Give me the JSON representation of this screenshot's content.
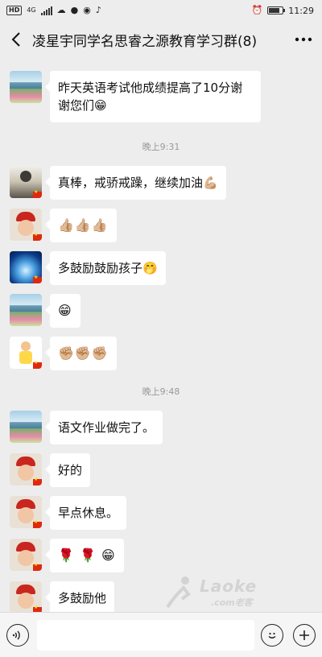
{
  "status_bar": {
    "hd_badge": "HD",
    "network": "4G",
    "time": "11:29"
  },
  "header": {
    "back_icon": "chevron-left-icon",
    "title": "凌星宇同学名思睿之源教育学习群(8)",
    "more_icon": "ellipsis-icon"
  },
  "messages": [
    {
      "avatar": "landscape",
      "text": "昨天英语考试他成绩提高了10分谢谢您们😁"
    },
    {
      "avatar": "girl",
      "text": "真棒，戒骄戒躁，继续加油💪🏼"
    },
    {
      "avatar": "boy",
      "text": "👍🏼👍🏼👍🏼"
    },
    {
      "avatar": "iceberg",
      "text": "多鼓励鼓励孩子🤭"
    },
    {
      "avatar": "landscape",
      "text": "😁"
    },
    {
      "avatar": "cartoon",
      "text": "✊🏼✊🏼✊🏼"
    },
    {
      "avatar": "landscape",
      "text": "语文作业做完了。"
    },
    {
      "avatar": "boy",
      "text": "好的"
    },
    {
      "avatar": "boy",
      "text": "早点休息。"
    },
    {
      "avatar": "boy",
      "text": "🌹 🌹 😁"
    },
    {
      "avatar": "boy",
      "text": "多鼓励他"
    }
  ],
  "time_separators": [
    "晚上9:31",
    "晚上9:48"
  ],
  "watermark": {
    "brand": "Laoke",
    "sub": ".com老客"
  },
  "input_bar": {
    "voice_icon": "voice-icon",
    "emoji_icon": "smiley-icon",
    "plus_icon": "plus-icon",
    "placeholder": ""
  },
  "colors": {
    "background": "#ededed",
    "bubble": "#ffffff",
    "flag": "#de2910"
  }
}
